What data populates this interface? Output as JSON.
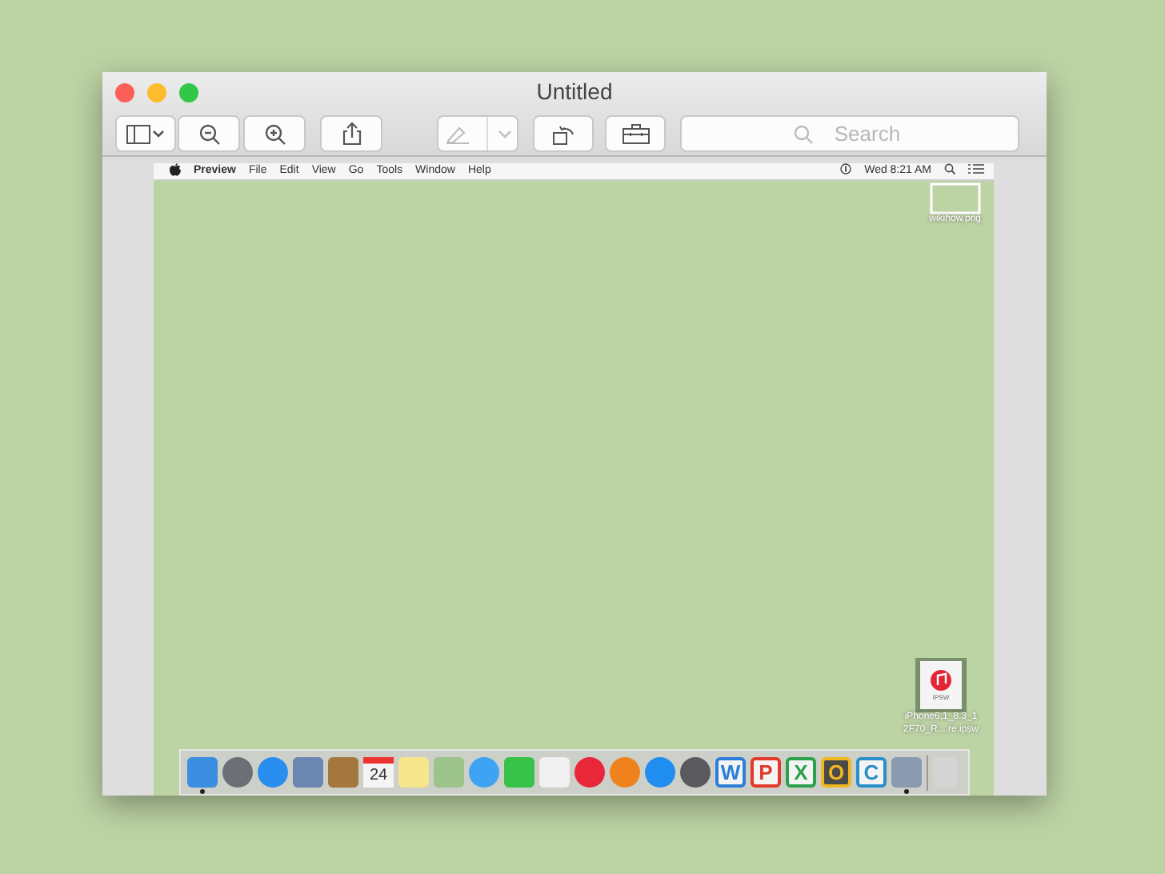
{
  "window": {
    "title": "Untitled"
  },
  "toolbar": {
    "markup_disabled": true,
    "search": {
      "placeholder": "Search"
    }
  },
  "menu_bar": {
    "items": [
      {
        "label": "Preview",
        "bold": true
      },
      {
        "label": "File",
        "bold": false
      },
      {
        "label": "Edit",
        "bold": false
      },
      {
        "label": "View",
        "bold": false
      },
      {
        "label": "Go",
        "bold": false
      },
      {
        "label": "Tools",
        "bold": false
      },
      {
        "label": "Window",
        "bold": false
      },
      {
        "label": "Help",
        "bold": false
      }
    ],
    "clock": "Wed 8:21 AM"
  },
  "desktop_files": [
    {
      "kind": "image",
      "label": "wikihow.png"
    },
    {
      "kind": "ipsw",
      "badge": "IPSW",
      "label": "iPhone6,1_8.3_1 2F70_R....re.ipsw"
    }
  ],
  "dock": [
    {
      "kind": "square",
      "color": "#3b8ee0",
      "running": true
    },
    {
      "kind": "round",
      "color": "#6c6f75",
      "running": false
    },
    {
      "kind": "round",
      "color": "#2a8ef0",
      "running": false
    },
    {
      "kind": "square",
      "color": "#6b86b0",
      "running": false
    },
    {
      "kind": "square",
      "color": "#a4773f",
      "running": false
    },
    {
      "kind": "calendar",
      "text": "24",
      "color": "#f4f4f4",
      "running": false
    },
    {
      "kind": "square",
      "color": "#f6e58a",
      "running": false
    },
    {
      "kind": "square",
      "color": "#9cc48a",
      "running": false
    },
    {
      "kind": "round",
      "color": "#3ea3f5",
      "running": false
    },
    {
      "kind": "square",
      "color": "#37c24a",
      "running": false
    },
    {
      "kind": "square",
      "color": "#f0f0f0",
      "running": false
    },
    {
      "kind": "round",
      "color": "#e8283a",
      "running": false
    },
    {
      "kind": "round",
      "color": "#f0821e",
      "running": false
    },
    {
      "kind": "round",
      "color": "#1f8ef0",
      "running": false
    },
    {
      "kind": "round",
      "color": "#5a5a5e",
      "running": false
    },
    {
      "kind": "letter",
      "text": "W",
      "color": "#2b7fd8",
      "running": false
    },
    {
      "kind": "letter",
      "text": "P",
      "color": "#e23a2a",
      "running": false
    },
    {
      "kind": "letter",
      "text": "X",
      "color": "#2aa14a",
      "running": false
    },
    {
      "kind": "letter",
      "text": "O",
      "color": "#f0b81e",
      "running": false
    },
    {
      "kind": "letter",
      "text": "C",
      "color": "#2a8fc8",
      "running": false
    },
    {
      "kind": "square",
      "color": "#8a9ab0",
      "running": true
    },
    {
      "kind": "trash",
      "color": "#d4d4d4",
      "running": false
    }
  ]
}
